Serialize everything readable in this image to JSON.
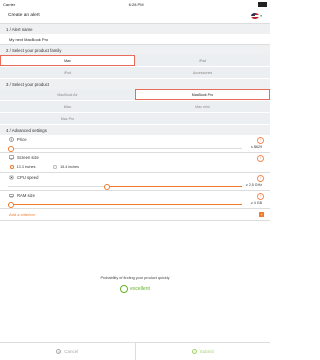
{
  "status": {
    "carrier": "Carrier",
    "time": "6:28 PM"
  },
  "header": {
    "title": "Create an alert"
  },
  "sections": {
    "alert_name": "1 / Alert name",
    "family": "2 / Select your product family",
    "product": "3 / Select your product",
    "advanced": "4 / Advanced settings"
  },
  "alert_name_value": "My next MacBook Pro",
  "families": [
    {
      "label": "Mac",
      "selected": true
    },
    {
      "label": "iPad",
      "selected": false
    },
    {
      "label": "iPod",
      "selected": false
    },
    {
      "label": "Accessories",
      "selected": false
    }
  ],
  "products": [
    {
      "label": "MacBook Air",
      "selected": false
    },
    {
      "label": "MacBook Pro",
      "selected": true
    },
    {
      "label": "iMac",
      "selected": false
    },
    {
      "label": "Mac mini",
      "selected": false
    },
    {
      "label": "Mac Pro",
      "selected": false
    },
    {
      "label": "",
      "selected": false
    }
  ],
  "advanced": {
    "price": {
      "label": "Price",
      "value_text": "≤ $629",
      "fraction": 0.02
    },
    "screen": {
      "label": "Screen size",
      "options": [
        "13.3 inches",
        "15.4 inches"
      ],
      "selected_index": 0
    },
    "cpu": {
      "label": "CPU speed",
      "value_text": "≥ 2.5 GHz",
      "fraction": 0.42
    },
    "ram": {
      "label": "RAM size",
      "value_text": "≥ 4 GB",
      "fraction": 0.02
    }
  },
  "add_criterion": "Add a criterion",
  "probability": {
    "label": "Probability of finding your product quickly",
    "rating": "excellent"
  },
  "footer": {
    "cancel": "Cancel",
    "submit": "Submit"
  },
  "colors": {
    "accent": "#f07a2a",
    "selected_border": "#e76a5a",
    "good": "#66b329"
  }
}
